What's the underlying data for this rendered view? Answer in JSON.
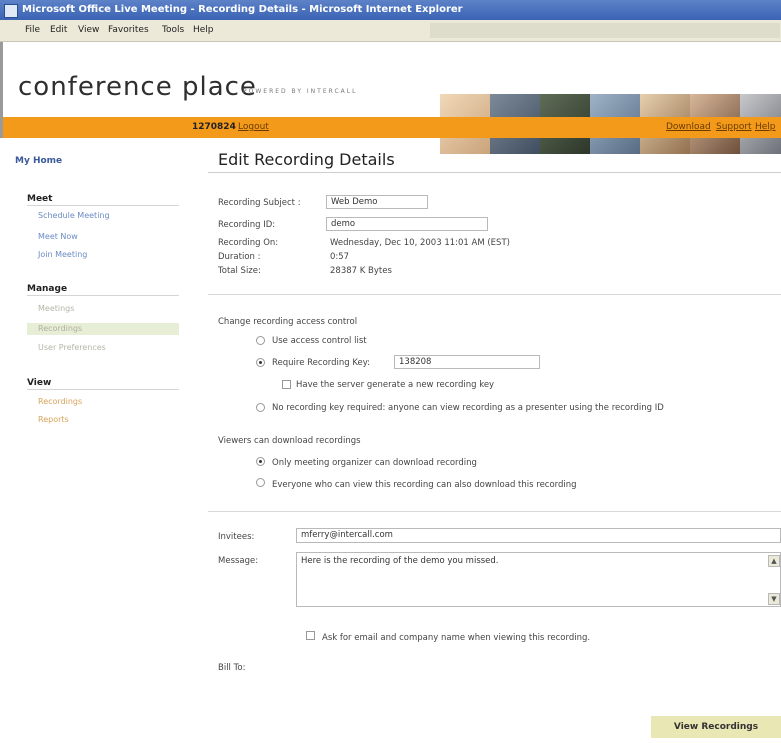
{
  "window": {
    "title": "Microsoft Office Live Meeting - Recording Details - Microsoft Internet Explorer"
  },
  "menubar": {
    "items": [
      "File",
      "Edit",
      "View",
      "Favorites",
      "Tools",
      "Help"
    ]
  },
  "brand": {
    "logo": "conference place",
    "powered_by": "POWERED BY INTERCALL"
  },
  "account": {
    "id": "1270824",
    "logout": "Logout",
    "links": [
      "Download",
      "Support",
      "Help"
    ]
  },
  "sidebar": {
    "my_home": "My Home",
    "meet": {
      "heading": "Meet",
      "items": [
        "Schedule Meeting",
        "Meet Now",
        "Join Meeting"
      ]
    },
    "manage": {
      "heading": "Manage",
      "items": [
        "Meetings",
        "Recordings",
        "User Preferences"
      ]
    },
    "view": {
      "heading": "View",
      "items": [
        "Recordings",
        "Reports"
      ]
    }
  },
  "page": {
    "title": "Edit Recording Details"
  },
  "details": {
    "subject_label": "Recording Subject :",
    "subject_value": "Web Demo",
    "id_label": "Recording ID:",
    "id_value": "demo",
    "on_label": "Recording On:",
    "on_value": "Wednesday, Dec 10, 2003 11:01 AM (EST)",
    "duration_label": "Duration :",
    "duration_value": "0:57",
    "size_label": "Total Size:",
    "size_value": "28387 K Bytes"
  },
  "access": {
    "heading": "Change recording access control",
    "opt1": "Use access control list",
    "opt2": "Require Recording Key:",
    "key_value": "138208",
    "generate": "Have the server generate a new recording key",
    "opt3": "No recording key required: anyone can view recording as a presenter using the recording ID"
  },
  "download": {
    "heading": "Viewers can download recordings",
    "opt1": "Only meeting organizer can download recording",
    "opt2": "Everyone who can view this recording can also download this recording"
  },
  "invite": {
    "invitees_label": "Invitees:",
    "invitees_value": "mferry@intercall.com",
    "message_label": "Message:",
    "message_value": "Here is the recording of the demo you missed.",
    "ask": "Ask for email and company name when viewing this recording.",
    "bill_to": "Bill To:"
  },
  "actions": {
    "view_recordings": "View Recordings"
  },
  "colors": {
    "accent_orange": "#f39a1b",
    "title_blue": "#3a63b3",
    "sidebar_link": "#6a8bc4",
    "button_bg": "#e9e7b4"
  }
}
